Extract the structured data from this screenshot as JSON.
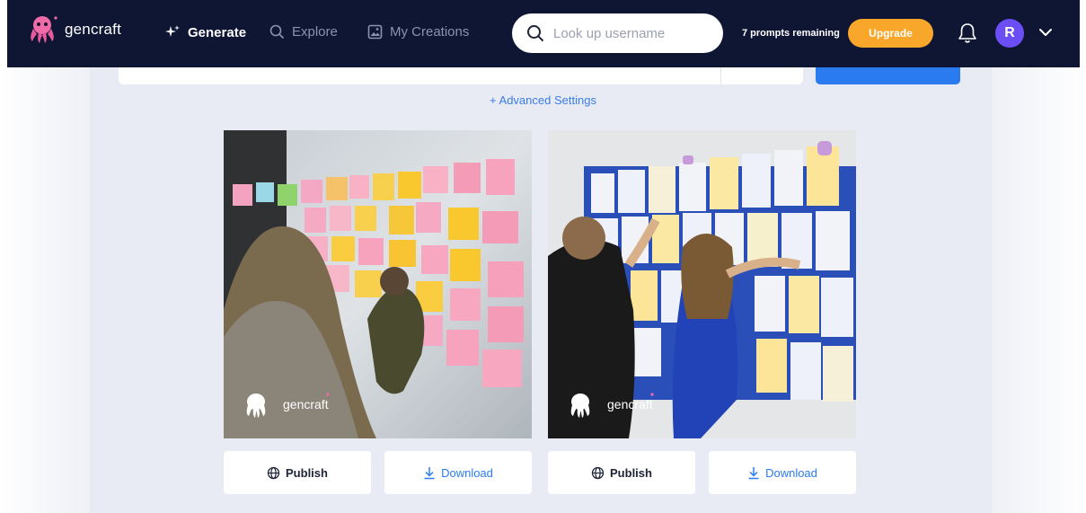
{
  "header": {
    "logo_text": "gencraft",
    "nav": [
      {
        "label": "Generate",
        "icon": "sparkle-icon",
        "active": true
      },
      {
        "label": "Explore",
        "icon": "search-icon",
        "active": false
      },
      {
        "label": "My Creations",
        "icon": "image-icon",
        "active": false
      }
    ],
    "search_placeholder": "Look up username",
    "prompts_remaining": "7 prompts remaining",
    "upgrade_label": "Upgrade",
    "avatar_initial": "R",
    "accent": "#2b7bf0",
    "upgrade_color": "#f9a72b",
    "nav_bg": "#0e1634"
  },
  "advanced_settings": "+ Advanced Settings",
  "results": [
    {
      "watermark": "gencraft",
      "publish_label": "Publish",
      "download_label": "Download"
    },
    {
      "watermark": "gencraft",
      "publish_label": "Publish",
      "download_label": "Download"
    }
  ]
}
